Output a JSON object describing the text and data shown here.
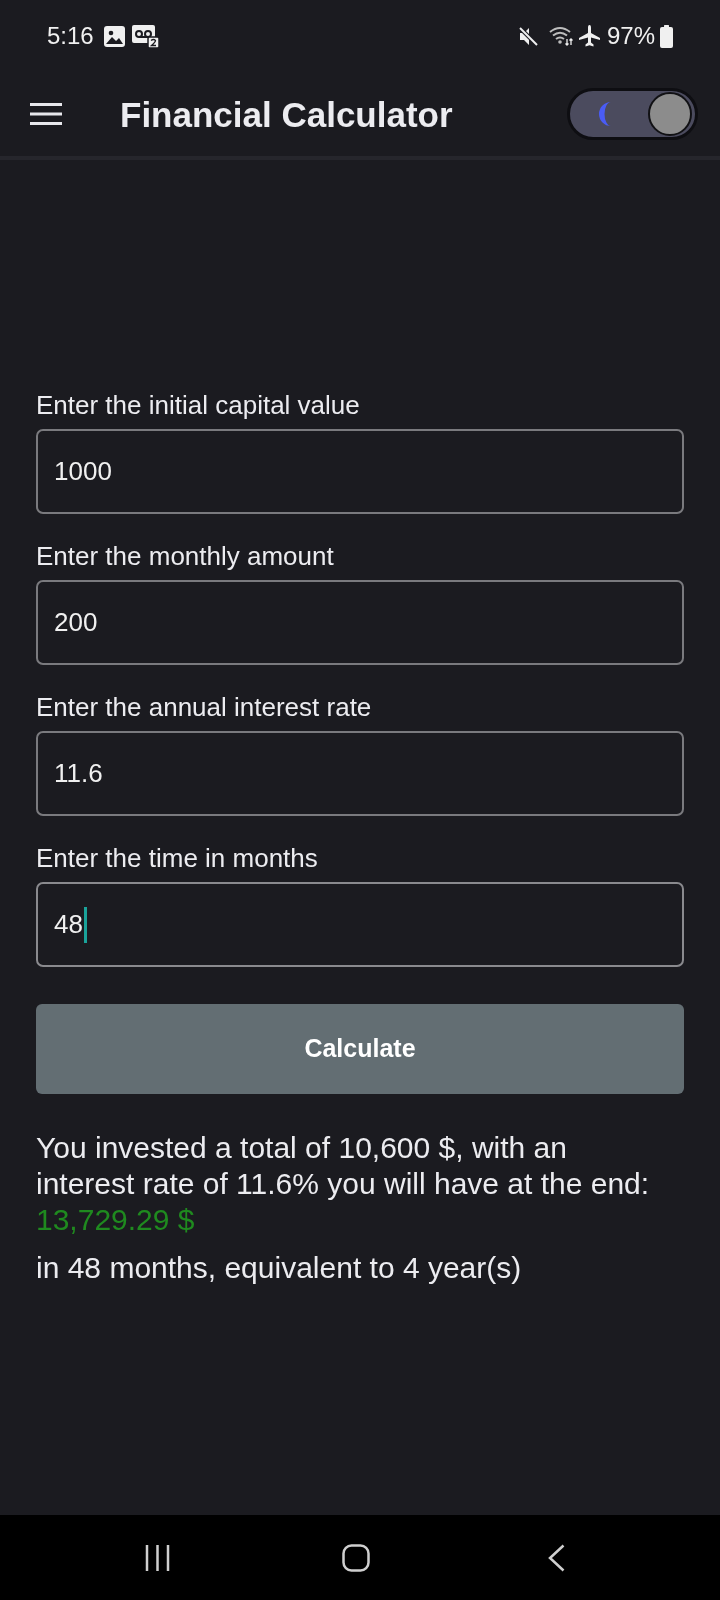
{
  "status_bar": {
    "time": "5:16",
    "battery": "97%"
  },
  "header": {
    "title": "Financial Calculator",
    "dark_mode_toggle": {
      "on": true
    }
  },
  "fields": [
    {
      "label": "Enter the initial capital value",
      "value": "1000",
      "focused": false
    },
    {
      "label": "Enter the monthly amount",
      "value": "200",
      "focused": false
    },
    {
      "label": "Enter the annual interest rate",
      "value": "11.6",
      "focused": false
    },
    {
      "label": "Enter the time in months",
      "value": "48",
      "focused": true
    }
  ],
  "calculate_button": {
    "label": "Calculate"
  },
  "result": {
    "summary": "You invested a total of 10,600 $, with an interest rate of 11.6% you will have at the end:",
    "amount": "13,729.29 $",
    "duration": "in 48 months, equivalent to 4 year(s)"
  }
}
